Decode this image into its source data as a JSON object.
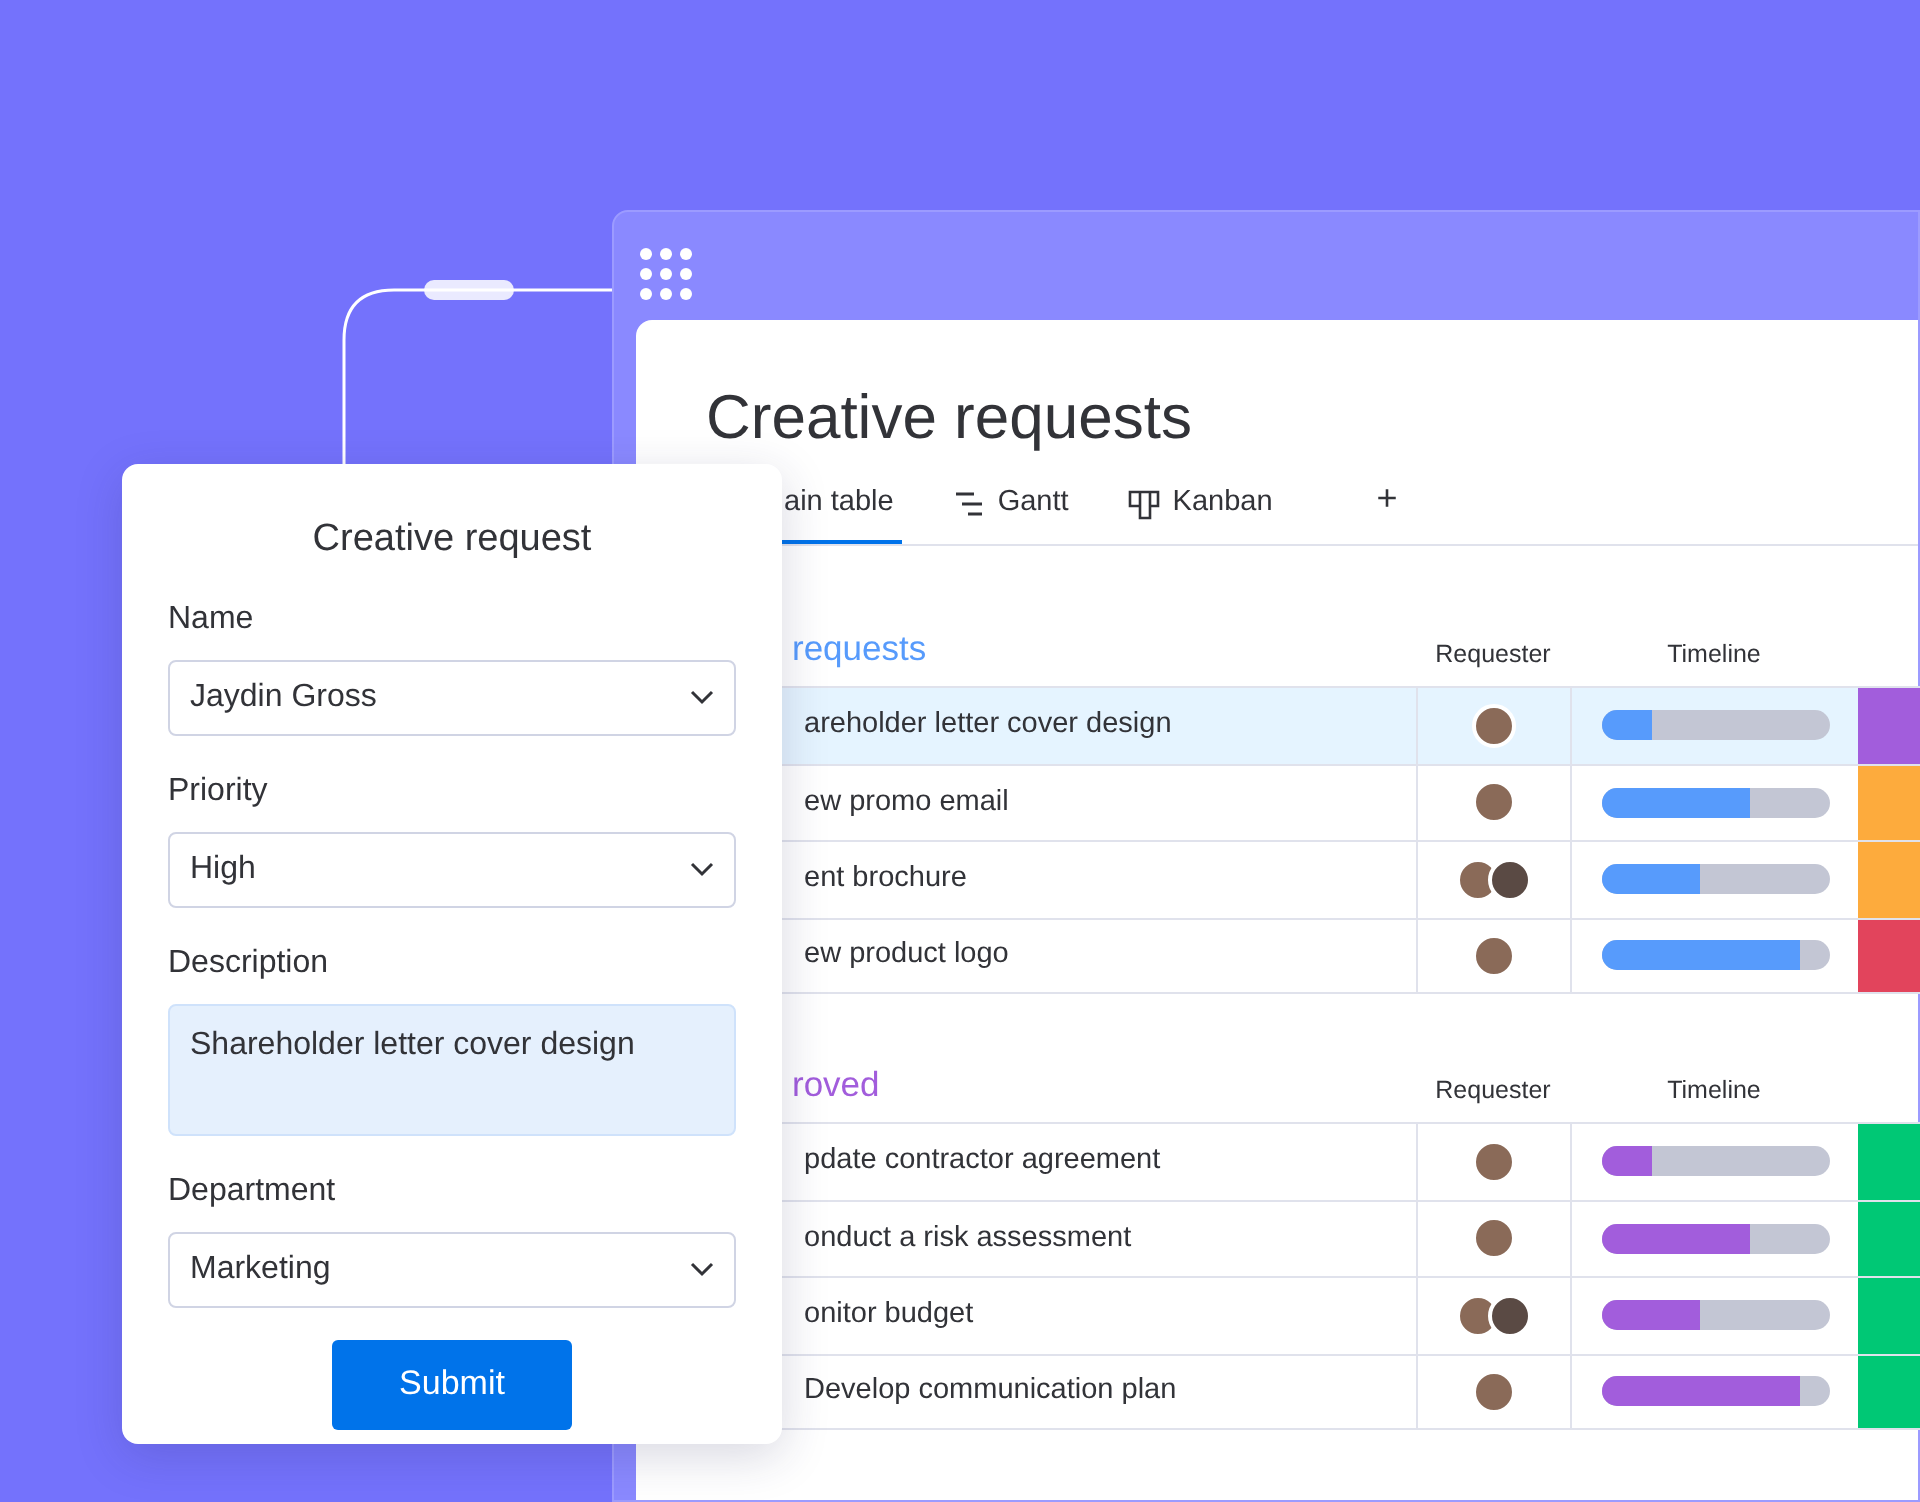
{
  "request_form": {
    "title": "Creative request",
    "fields": [
      {
        "kind": "select",
        "label": "Name",
        "value": "Jaydin Gross"
      },
      {
        "kind": "select",
        "label": "Priority",
        "value": "High"
      },
      {
        "kind": "textarea",
        "label": "Description",
        "value": "Shareholder letter cover design"
      },
      {
        "kind": "select",
        "label": "Department",
        "value": "Marketing"
      }
    ],
    "submit": "Submit"
  },
  "board": {
    "title": "Creative requests",
    "tabs": [
      {
        "label": "ain table",
        "kind": "table",
        "selected": true
      },
      {
        "label": "Gantt",
        "kind": "gantt",
        "selected": false
      },
      {
        "label": "Kanban",
        "kind": "kanban",
        "selected": false
      },
      {
        "label": "+",
        "kind": "add",
        "selected": false
      }
    ],
    "groups": [
      {
        "title": "requests",
        "color": "#579bfc",
        "columns": [
          "Requester",
          "Timeline"
        ],
        "rows": [
          {
            "name": "areholder letter cover design",
            "selected": true,
            "requester": {
              "kind": "single"
            },
            "level": 0.22,
            "color": "#a25ddc"
          },
          {
            "name": "ew promo email",
            "selected": false,
            "requester": {
              "kind": "single"
            },
            "level": 0.65,
            "color": "#fdab3d"
          },
          {
            "name": "ent brochure",
            "selected": false,
            "requester": {
              "kind": "pair"
            },
            "level": 0.43,
            "color": "#fdab3d"
          },
          {
            "name": "ew product logo",
            "selected": false,
            "requester": {
              "kind": "single"
            },
            "level": 0.87,
            "color": "#e2445c"
          }
        ]
      },
      {
        "title": "roved",
        "color": "#a25ddc",
        "columns": [
          "Requester",
          "Timeline"
        ],
        "rows": [
          {
            "name": "pdate contractor agreement",
            "selected": false,
            "requester": {
              "kind": "single"
            },
            "level": 0.22,
            "color": "#00c875"
          },
          {
            "name": "onduct a risk assessment",
            "selected": false,
            "requester": {
              "kind": "single"
            },
            "level": 0.65,
            "color": "#00c875"
          },
          {
            "name": "onitor budget",
            "selected": false,
            "requester": {
              "kind": "pair"
            },
            "level": 0.43,
            "color": "#00c875"
          },
          {
            "name": "Develop communication plan",
            "selected": false,
            "requester": {
              "kind": "single"
            },
            "level": 0.87,
            "color": "#00c875"
          }
        ]
      }
    ]
  }
}
